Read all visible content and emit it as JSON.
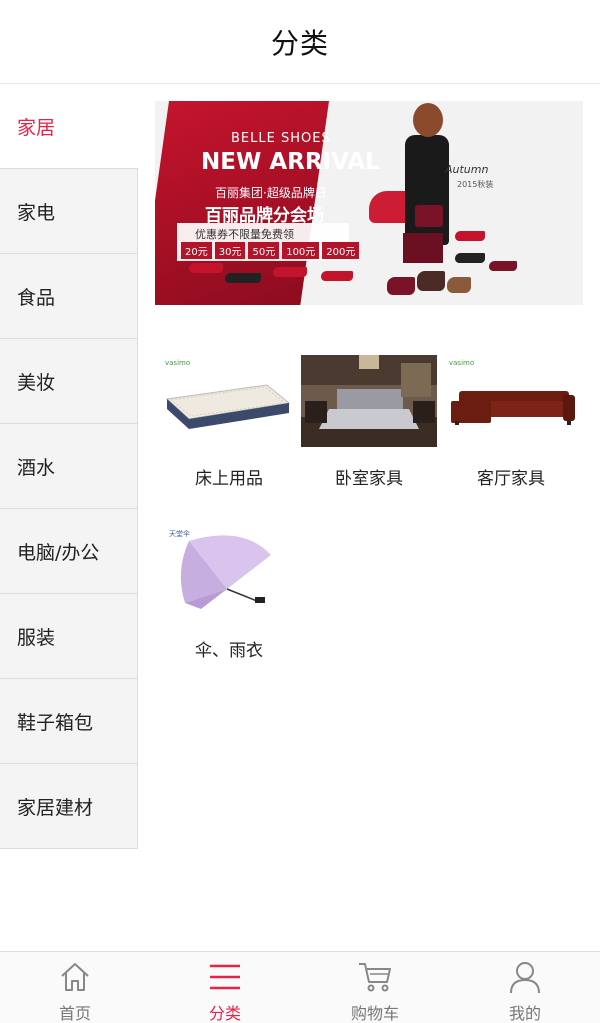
{
  "header": {
    "title": "分类"
  },
  "sidebar": {
    "items": [
      {
        "label": "家居",
        "active": true
      },
      {
        "label": "家电",
        "active": false
      },
      {
        "label": "食品",
        "active": false
      },
      {
        "label": "美妆",
        "active": false
      },
      {
        "label": "酒水",
        "active": false
      },
      {
        "label": "电脑/办公",
        "active": false
      },
      {
        "label": "服装",
        "active": false
      },
      {
        "label": "鞋子箱包",
        "active": false
      },
      {
        "label": "家居建材",
        "active": false
      }
    ]
  },
  "banner": {
    "brand": "BELLE SHOES",
    "headline": "NEW ARRIVAL",
    "subtitle": "百丽集团·超级品牌日",
    "venue": "百丽品牌分会场",
    "coupon_text": "优惠券不限量免费领",
    "coupons": [
      "20元",
      "30元",
      "50元",
      "100元",
      "200元"
    ],
    "autumn": "Autumn",
    "autumn_sub": "2015秋装"
  },
  "categories": [
    {
      "label": "床上用品",
      "icon": "mattress-image"
    },
    {
      "label": "卧室家具",
      "icon": "bedroom-image"
    },
    {
      "label": "客厅家具",
      "icon": "sofa-image"
    },
    {
      "label": "伞、雨衣",
      "icon": "umbrella-image"
    }
  ],
  "thumb_marks": {
    "vasimo": "vasimo",
    "umbrella_brand": "天堂伞"
  },
  "tabbar": {
    "tabs": [
      {
        "label": "首页",
        "icon": "home-icon",
        "active": false
      },
      {
        "label": "分类",
        "icon": "menu-icon",
        "active": true
      },
      {
        "label": "购物车",
        "icon": "cart-icon",
        "active": false
      },
      {
        "label": "我的",
        "icon": "user-icon",
        "active": false
      }
    ]
  },
  "colors": {
    "accent": "#e8224a",
    "sidebar_bg": "#f4f4f4",
    "divider": "#dcdcdc"
  }
}
